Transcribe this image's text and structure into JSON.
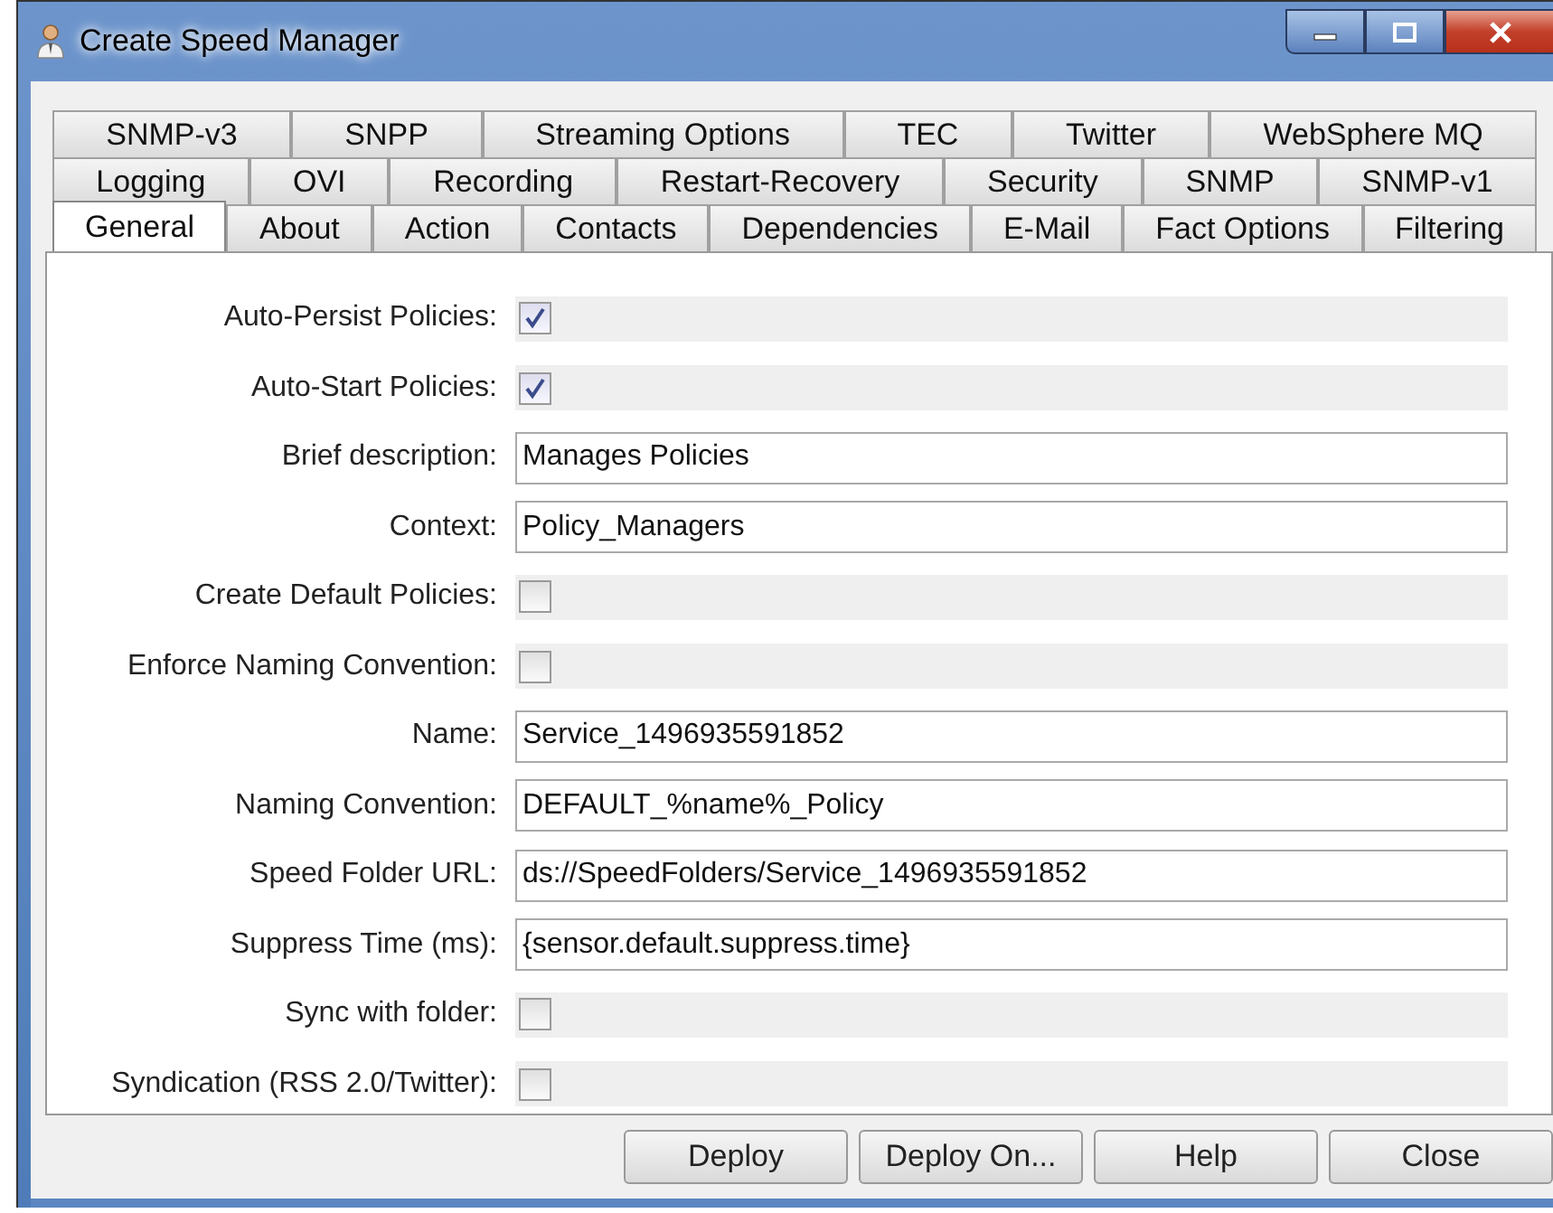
{
  "window": {
    "title": "Create Speed Manager"
  },
  "tab_rows": [
    [
      {
        "label": "SNMP-v3",
        "selected": false
      },
      {
        "label": "SNPP",
        "selected": false
      },
      {
        "label": "Streaming Options",
        "selected": false
      },
      {
        "label": "TEC",
        "selected": false
      },
      {
        "label": "Twitter",
        "selected": false
      },
      {
        "label": "WebSphere MQ",
        "selected": false
      }
    ],
    [
      {
        "label": "Logging",
        "selected": false
      },
      {
        "label": "OVI",
        "selected": false
      },
      {
        "label": "Recording",
        "selected": false
      },
      {
        "label": "Restart-Recovery",
        "selected": false
      },
      {
        "label": "Security",
        "selected": false
      },
      {
        "label": "SNMP",
        "selected": false
      },
      {
        "label": "SNMP-v1",
        "selected": false
      }
    ],
    [
      {
        "label": "General",
        "selected": true
      },
      {
        "label": "About",
        "selected": false
      },
      {
        "label": "Action",
        "selected": false
      },
      {
        "label": "Contacts",
        "selected": false
      },
      {
        "label": "Dependencies",
        "selected": false
      },
      {
        "label": "E-Mail",
        "selected": false
      },
      {
        "label": "Fact Options",
        "selected": false
      },
      {
        "label": "Filtering",
        "selected": false
      }
    ]
  ],
  "fields": [
    {
      "kind": "checkbox",
      "label": "Auto-Persist Policies:",
      "checked": true
    },
    {
      "kind": "checkbox",
      "label": "Auto-Start Policies:",
      "checked": true
    },
    {
      "kind": "text",
      "label": "Brief description:",
      "value": "Manages Policies"
    },
    {
      "kind": "text",
      "label": "Context:",
      "value": "Policy_Managers"
    },
    {
      "kind": "checkbox",
      "label": "Create Default Policies:",
      "checked": false
    },
    {
      "kind": "checkbox",
      "label": "Enforce Naming Convention:",
      "checked": false
    },
    {
      "kind": "text",
      "label": "Name:",
      "value": "Service_1496935591852"
    },
    {
      "kind": "text",
      "label": "Naming Convention:",
      "value": "DEFAULT_%name%_Policy"
    },
    {
      "kind": "text",
      "label": "Speed Folder URL:",
      "value": "ds://SpeedFolders/Service_1496935591852"
    },
    {
      "kind": "text",
      "label": "Suppress Time (ms):",
      "value": "{sensor.default.suppress.time}"
    },
    {
      "kind": "checkbox",
      "label": "Sync with folder:",
      "checked": false
    },
    {
      "kind": "checkbox",
      "label": "Syndication (RSS 2.0/Twitter):",
      "checked": false
    }
  ],
  "buttons": [
    "Deploy",
    "Deploy On...",
    "Help",
    "Close"
  ]
}
